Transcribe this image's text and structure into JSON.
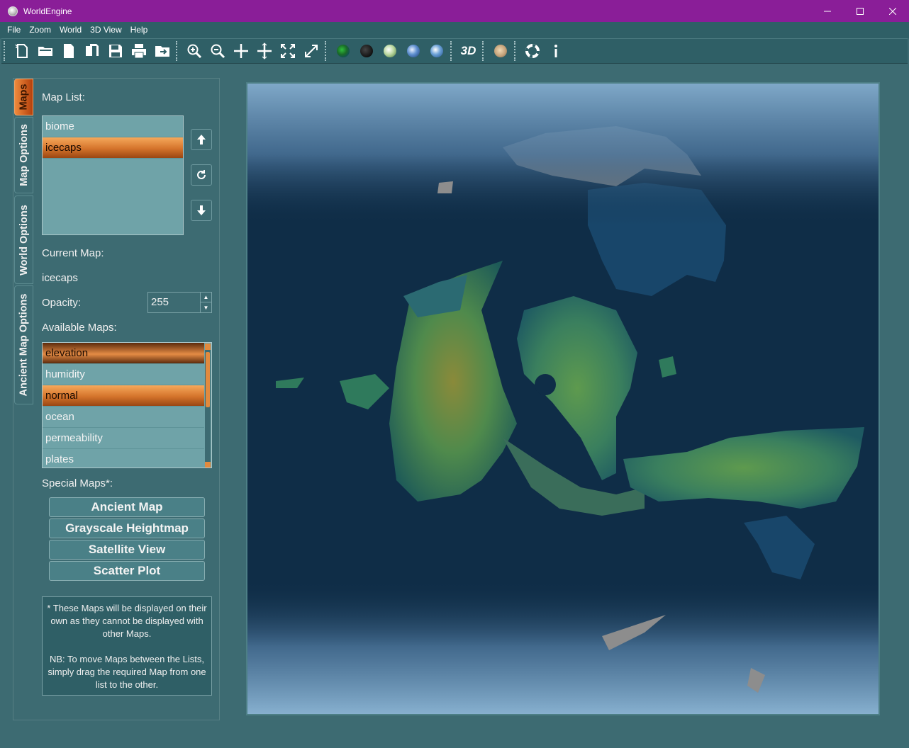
{
  "window": {
    "title": "WorldEngine",
    "controls": {
      "minimize": "—",
      "maximize": "☐",
      "close": "✕"
    }
  },
  "menu": [
    "File",
    "Zoom",
    "World",
    "3D View",
    "Help"
  ],
  "toolbar": {
    "file_group": [
      "new-file-icon",
      "open-folder-icon",
      "open-file-icon",
      "copy-icon",
      "save-icon",
      "print-icon",
      "export-icon"
    ],
    "zoom_group": [
      "zoom-in-icon",
      "zoom-out-icon",
      "move-icon",
      "center-icon",
      "fit-screen-icon",
      "fullscreen-icon"
    ],
    "world_group": [
      "world-green-icon",
      "world-dark-icon",
      "world-white-icon",
      "world-blue-icon",
      "world-globe-icon"
    ],
    "view3d_label": "3D",
    "misc_group": [
      "compass-icon",
      "help-icon",
      "info-icon"
    ]
  },
  "tabs": [
    "Maps",
    "Map Options",
    "World Options",
    "Ancient Map Options"
  ],
  "map_list": {
    "label": "Map List:",
    "items": [
      "biome",
      "icecaps"
    ],
    "selected": "icecaps"
  },
  "current_map": {
    "label": "Current Map:",
    "value": "icecaps"
  },
  "opacity": {
    "label": "Opacity:",
    "value": "255"
  },
  "available_maps": {
    "label": "Available Maps:",
    "items": [
      "elevation",
      "humidity",
      "normal",
      "ocean",
      "permeability",
      "plates"
    ],
    "selected": [
      "elevation",
      "normal"
    ]
  },
  "special_maps": {
    "label": "Special Maps*:",
    "buttons": [
      "Ancient Map",
      "Grayscale Heightmap",
      "Satellite View",
      "Scatter Plot"
    ]
  },
  "note": "* These Maps will be displayed on their own as they cannot be displayed with other Maps.\n\nNB: To move Maps between the Lists, simply drag the required Map from one list to the other.",
  "colors": {
    "title_bar": "#8a1e98",
    "panel_bg": "#3d6b72",
    "accent_orange": "#e28a3e",
    "ocean": "#0e2c46"
  }
}
